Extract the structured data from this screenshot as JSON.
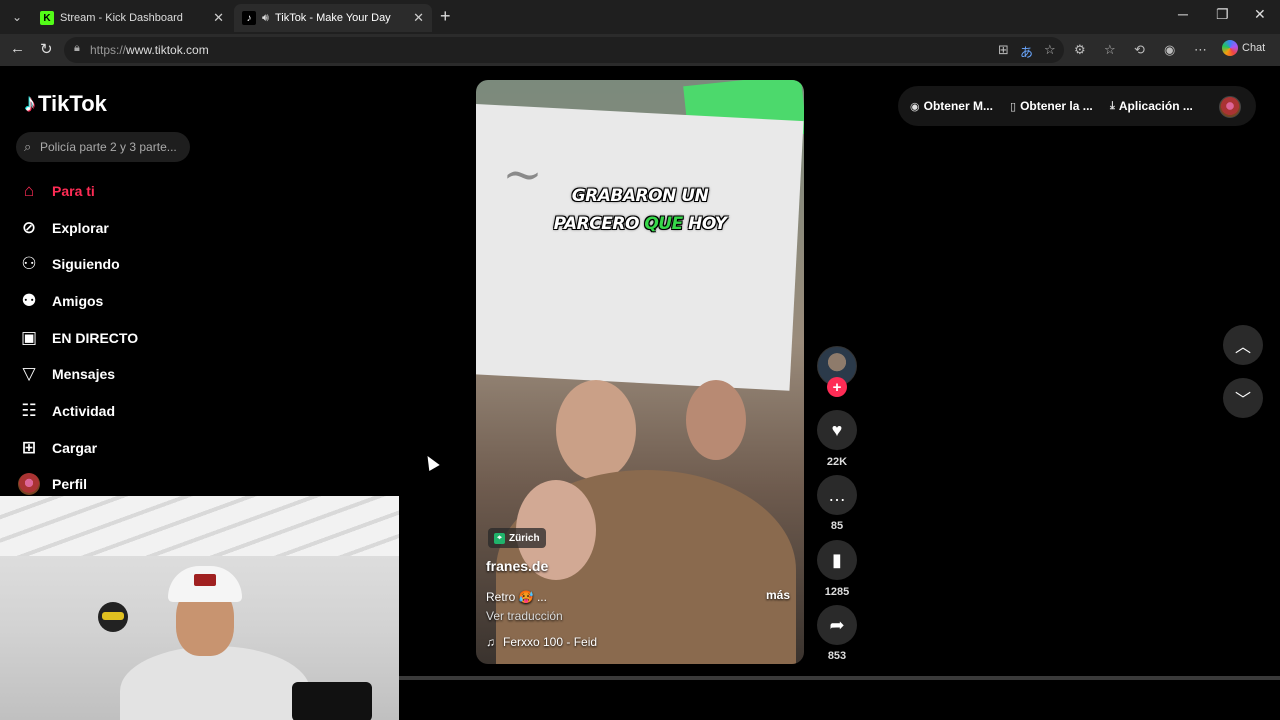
{
  "browser": {
    "tabs": [
      {
        "title": "Stream - Kick Dashboard",
        "favicon": "kick-icon",
        "active": false
      },
      {
        "title": "TikTok - Make Your Day",
        "favicon": "tiktok-icon",
        "active": true
      }
    ],
    "url_prefix": "https://",
    "url_host": "www.tiktok.com",
    "chat_label": "Chat"
  },
  "sidebar": {
    "logo_text": "TikTok",
    "search_placeholder": "Policía parte 2 y 3 parte...",
    "items": [
      {
        "label": "Para ti",
        "icon": "home-icon",
        "active": true
      },
      {
        "label": "Explorar",
        "icon": "compass-icon",
        "active": false
      },
      {
        "label": "Siguiendo",
        "icon": "following-icon",
        "active": false
      },
      {
        "label": "Amigos",
        "icon": "friends-icon",
        "active": false
      },
      {
        "label": "EN DIRECTO",
        "icon": "live-icon",
        "active": false
      },
      {
        "label": "Mensajes",
        "icon": "messages-icon",
        "active": false
      },
      {
        "label": "Actividad",
        "icon": "activity-icon",
        "active": false
      },
      {
        "label": "Cargar",
        "icon": "upload-icon",
        "active": false
      },
      {
        "label": "Perfil",
        "icon": "profile-avatar",
        "active": false
      }
    ]
  },
  "video": {
    "caption_line1": "GRABARON UN",
    "caption_line2_a": "PARCERO ",
    "caption_line2_highlight": "QUE",
    "caption_line2_b": " HOY",
    "location": "Zürich",
    "author": "franes.de",
    "description": "Retro 🥵 ...",
    "more_label": "más",
    "translate_label": "Ver traducción",
    "music": "Ferxxo 100 - Feid"
  },
  "actions": {
    "likes": "22K",
    "comments": "85",
    "saves": "1285",
    "shares": "853"
  },
  "topbar": {
    "get_coins_label": "Obtener M...",
    "get_app_label": "Obtener la ...",
    "desktop_app_label": "Aplicación ..."
  },
  "colors": {
    "accent": "#fe2c55",
    "caption_highlight": "#37d84a",
    "location_badge": "#20b36b"
  }
}
